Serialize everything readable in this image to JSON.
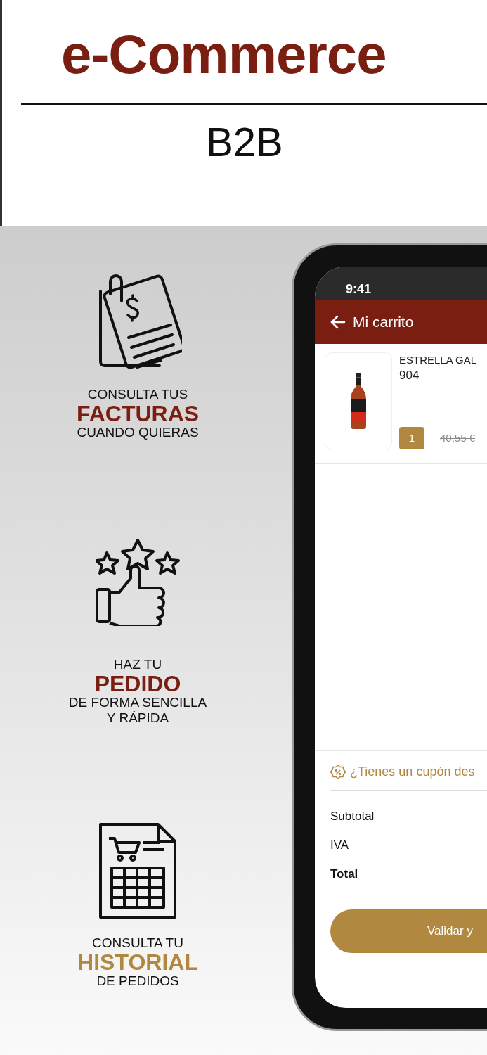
{
  "header": {
    "title": "e-Commerce",
    "subtitle": "B2B"
  },
  "features": [
    {
      "kind": "invoices",
      "line1": "CONSULTA TUS",
      "highlight": "FACTURAS",
      "color": "#7a1e12",
      "line2": "CUANDO QUIERAS"
    },
    {
      "kind": "order",
      "line1": "HAZ TU",
      "highlight": "PEDIDO",
      "color": "#7a1e12",
      "line2": "DE FORMA SENCILLA\nY RÁPIDA"
    },
    {
      "kind": "history",
      "line1": "CONSULTA TU",
      "highlight": "HISTORIAL",
      "color": "#b08840",
      "line2": "DE PEDIDOS"
    }
  ],
  "phone": {
    "time": "9:41",
    "screen_title": "Mi carrito",
    "cart_item": {
      "name": "ESTRELLA GAL",
      "code": "904",
      "quantity": "1",
      "old_price": "40,55 €"
    },
    "coupon": "¿Tienes un cupón des",
    "totals": [
      {
        "label": "Subtotal",
        "bold": false
      },
      {
        "label": "IVA",
        "bold": false
      },
      {
        "label": "Total",
        "bold": true
      }
    ],
    "button": "Validar y"
  }
}
